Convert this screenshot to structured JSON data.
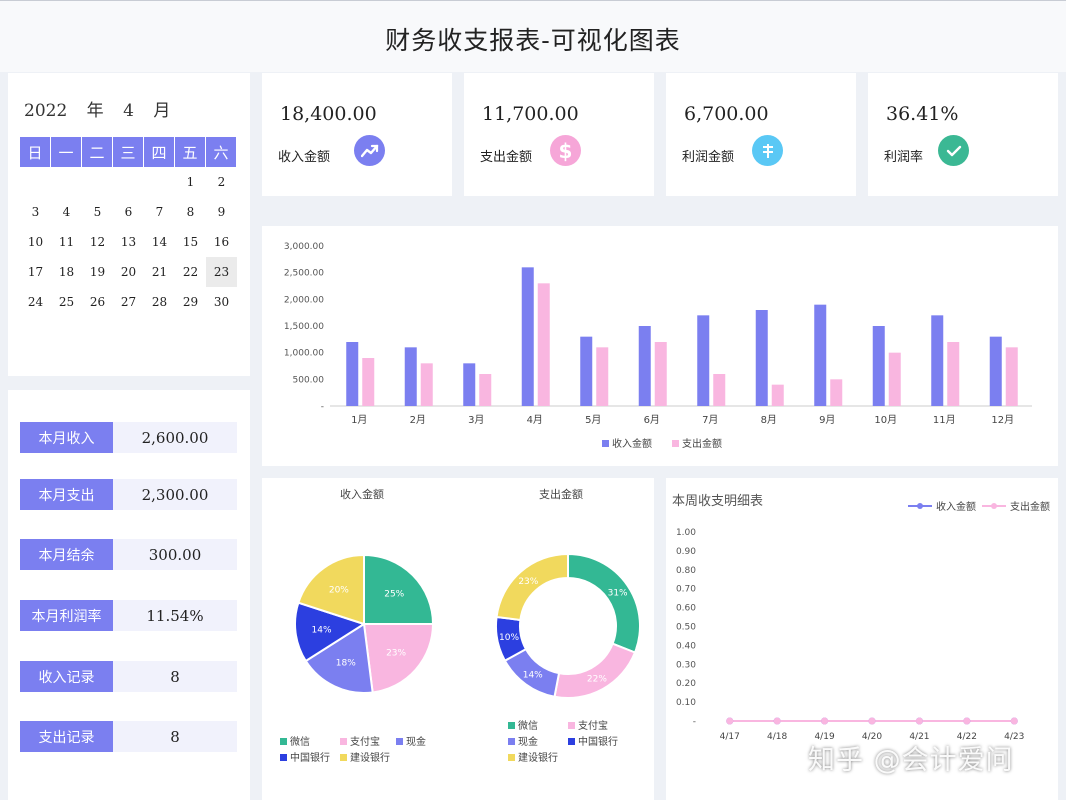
{
  "title": "财务收支报表-可视化图表",
  "calendar": {
    "year": "2022",
    "year_unit": "年",
    "month": "4",
    "month_unit": "月",
    "weekdays": [
      "日",
      "一",
      "二",
      "三",
      "四",
      "五",
      "六"
    ],
    "weeks": [
      [
        "",
        "",
        "",
        "",
        "",
        "1",
        "2"
      ],
      [
        "3",
        "4",
        "5",
        "6",
        "7",
        "8",
        "9"
      ],
      [
        "10",
        "11",
        "12",
        "13",
        "14",
        "15",
        "16"
      ],
      [
        "17",
        "18",
        "19",
        "20",
        "21",
        "22",
        "23"
      ],
      [
        "24",
        "25",
        "26",
        "27",
        "28",
        "29",
        "30"
      ]
    ],
    "highlight": "23"
  },
  "kpis": [
    {
      "value": "18,400.00",
      "label": "收入金额",
      "icon": "trend-up-icon",
      "color": "#7b7ff0"
    },
    {
      "value": "11,700.00",
      "label": "支出金额",
      "icon": "dollar-icon",
      "color": "#f6a6d8"
    },
    {
      "value": "6,700.00",
      "label": "利润金额",
      "icon": "yuan-icon",
      "color": "#5ac8f5"
    },
    {
      "value": "36.41%",
      "label": "利润率",
      "icon": "check-icon",
      "color": "#3bb894"
    }
  ],
  "summary": [
    {
      "label": "本月收入",
      "value": "2,600.00"
    },
    {
      "label": "本月支出",
      "value": "2,300.00"
    },
    {
      "label": "本月结余",
      "value": "300.00"
    },
    {
      "label": "本月利润率",
      "value": "11.54%"
    },
    {
      "label": "收入记录",
      "value": "8"
    },
    {
      "label": "支出记录",
      "value": "8"
    }
  ],
  "colors": {
    "income": "#7b7ff0",
    "expense": "#f9b6e0",
    "panel": "#ffffff"
  },
  "chart_data": [
    {
      "type": "bar",
      "categories": [
        "1月",
        "2月",
        "3月",
        "4月",
        "5月",
        "6月",
        "7月",
        "8月",
        "9月",
        "10月",
        "11月",
        "12月"
      ],
      "series": [
        {
          "name": "收入金额",
          "values": [
            1200,
            1100,
            800,
            2600,
            1300,
            1500,
            1700,
            1800,
            1900,
            1500,
            1700,
            1300
          ]
        },
        {
          "name": "支出金额",
          "values": [
            900,
            800,
            600,
            2300,
            1100,
            1200,
            600,
            400,
            500,
            1000,
            1200,
            1100
          ]
        }
      ],
      "yticks": [
        "3,000.00",
        "2,500.00",
        "2,000.00",
        "1,500.00",
        "1,000.00",
        "500.00",
        "-"
      ],
      "ylim": [
        0,
        3000
      ],
      "legend": "bottom"
    },
    {
      "type": "pie",
      "title": "收入金额",
      "labels": [
        "微信",
        "支付宝",
        "现金",
        "中国银行",
        "建设银行"
      ],
      "values": [
        25,
        23,
        18,
        14,
        20
      ],
      "value_labels": [
        "25%",
        "23%",
        "18%",
        "14%",
        "20%"
      ],
      "colors": [
        "#33b894",
        "#f9b6e0",
        "#7b7ff0",
        "#2c3fe0",
        "#f1d95d"
      ]
    },
    {
      "type": "pie",
      "title": "支出金额",
      "labels": [
        "微信",
        "支付宝",
        "现金",
        "中国银行",
        "建设银行"
      ],
      "values": [
        31,
        22,
        14,
        10,
        23
      ],
      "value_labels": [
        "31%",
        "22%",
        "14%",
        "10%",
        "23%"
      ],
      "colors": [
        "#33b894",
        "#f9b6e0",
        "#7b7ff0",
        "#2c3fe0",
        "#f1d95d"
      ]
    },
    {
      "type": "line",
      "title": "本周收支明细表",
      "x": [
        "4/17",
        "4/18",
        "4/19",
        "4/20",
        "4/21",
        "4/22",
        "4/23"
      ],
      "series": [
        {
          "name": "收入金额",
          "values": [
            0,
            0,
            0,
            0,
            0,
            0,
            0
          ]
        },
        {
          "name": "支出金额",
          "values": [
            0,
            0,
            0,
            0,
            0,
            0,
            0
          ]
        }
      ],
      "yticks": [
        "1.00",
        "0.90",
        "0.80",
        "0.70",
        "0.60",
        "0.50",
        "0.40",
        "0.30",
        "0.20",
        "0.10",
        "-"
      ],
      "ylim": [
        0,
        1
      ],
      "legend": "top-right"
    }
  ],
  "watermark": "知乎 @会计爱问"
}
